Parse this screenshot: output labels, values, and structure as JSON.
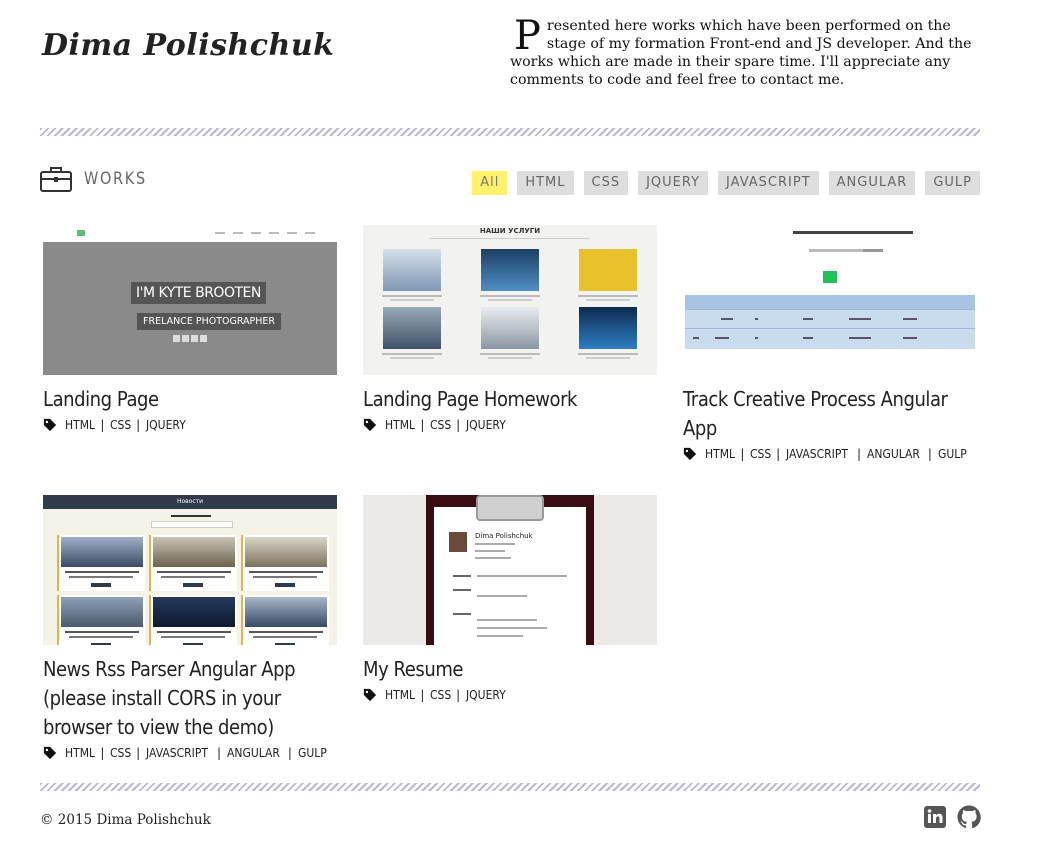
{
  "header": {
    "logo": "Dima Polishchuk",
    "intro_first_letter": "P",
    "intro_rest": "resented here works which have been performed on the stage of my formation Front-end and JS developer. And the works which are made in their spare time. I'll appreciate any comments to code and feel free to contact me."
  },
  "works": {
    "title": "WORKS",
    "icon": "briefcase-icon",
    "filters": [
      "All",
      "HTML",
      "CSS",
      "JQUERY",
      "JAVASCRIPT",
      "ANGULAR",
      "GULP"
    ],
    "active_filter": "All",
    "active_color": "#fff26a"
  },
  "cards": [
    {
      "title": "Landing Page",
      "tags": [
        "HTML",
        "CSS",
        "JQUERY"
      ],
      "thumb": {
        "hero_title": "I'M KYTE BROOTEN",
        "hero_subtitle": "FRELANCE PHOTOGRAPHER"
      }
    },
    {
      "title": "Landing Page Homework",
      "tags": [
        "HTML",
        "CSS",
        "JQUERY"
      ],
      "thumb": {
        "heading": "НАШИ УСЛУГИ"
      }
    },
    {
      "title": "Track Creative Process Angular App",
      "tags": [
        "HTML",
        "CSS",
        "JAVASCRIPT",
        "ANGULAR",
        "GULP"
      ],
      "thumb": {}
    },
    {
      "title": "News Rss Parser Angular App (please install CORS in your browser to view the demo)",
      "tags": [
        "HTML",
        "CSS",
        "JAVASCRIPT",
        "ANGULAR",
        "GULP"
      ],
      "thumb": {
        "heading": "Новости"
      }
    },
    {
      "title": "My Resume",
      "tags": [
        "HTML",
        "CSS",
        "JQUERY"
      ],
      "thumb": {
        "name": "Dima Polishchuk"
      }
    }
  ],
  "footer": {
    "copyright": "© 2015 Dima Polishchuk",
    "social": [
      "linkedin-icon",
      "github-icon"
    ]
  }
}
